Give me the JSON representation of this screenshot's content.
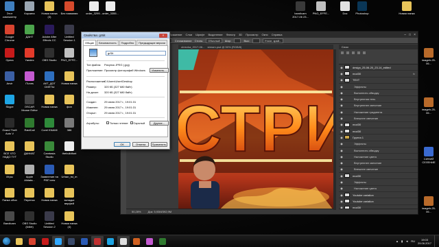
{
  "desktop": {
    "left_icons": [
      {
        "label": "Этот компьютер",
        "color": "#3f7fbf"
      },
      {
        "label": "Корзина",
        "color": "#9aa6b2"
      },
      {
        "label": "Новая папка (3)",
        "color": "#e8c45a"
      },
      {
        "label": "Без названия",
        "color": "#d64a2c"
      },
      {
        "label": "Google Chrome",
        "color": "#d8432f"
      },
      {
        "label": "ДАНТ",
        "color": "#4ca44c"
      },
      {
        "label": "Adobe After Effects CC",
        "color": "#2a1a5a"
      },
      {
        "label": "Untitled Session 1",
        "color": "#3a3a4a"
      },
      {
        "label": "Opera",
        "color": "#c61a1a"
      },
      {
        "label": "Yandex",
        "color": "#e23a2a"
      },
      {
        "label": "OBS Studio",
        "color": "#303030"
      },
      {
        "label": "PNG_EFFE...",
        "color": "#c0c0c0"
      },
      {
        "label": "Anvir",
        "color": "#3b5fa4"
      },
      {
        "label": "iTunes",
        "color": "#c45ad0"
      },
      {
        "label": "АКТ_ДОГ СМЕТЫ",
        "color": "#2e6fbf"
      },
      {
        "label": "Новая папка",
        "color": "#e8c45a"
      },
      {
        "label": "Skype",
        "color": "#1ea5e4"
      },
      {
        "label": "OSCAR Mouse Editor",
        "color": "#444"
      },
      {
        "label": "Новая папка",
        "color": "#e8c45a"
      },
      {
        "label": "фон",
        "color": "#e8c45a"
      },
      {
        "label": "Grand Theft Auto V",
        "color": "#2a2a2a"
      },
      {
        "label": "RaidCall",
        "color": "#2f7a2f"
      },
      {
        "label": "Corel KNAMI",
        "color": "#2e8a3a"
      },
      {
        "label": "386",
        "color": "#7a7a7a"
      },
      {
        "label": "ВСЕ ЧТО НАДО ТУТ",
        "color": "#e8c45a"
      },
      {
        "label": "ДАНИАТ",
        "color": "#e8c45a"
      },
      {
        "label": "Camtasia Studio",
        "color": "#3a8a3a"
      },
      {
        "label": "thebuildfont",
        "color": "#ececec"
      },
      {
        "label": "Игры",
        "color": "#e8c45a"
      },
      {
        "label": "Apple Alldata...",
        "color": "#b0b0b0"
      },
      {
        "label": "Заявление на РВП new",
        "color": "#2b5bb5"
      },
      {
        "label": "Urban_tst_m",
        "color": "#e8c45a"
      },
      {
        "label": "Папка обои",
        "color": "#e8c45a"
      },
      {
        "label": "Перенос",
        "color": "#e8c45a"
      },
      {
        "label": "Новая папка",
        "color": "#e8c45a"
      },
      {
        "label": "вкладки верфей",
        "color": "#e8c45a"
      },
      {
        "label": "Bandicam",
        "color": "#4a4a4a"
      },
      {
        "label": "OBS Studio (64bit)",
        "color": "#303030"
      },
      {
        "label": "Untitled Session 2",
        "color": "#3a3a4a"
      },
      {
        "label": "Новая папка (4)",
        "color": "#e8c45a"
      }
    ],
    "top_icons": [
      {
        "label": "order_3299...",
        "color": "#ececec"
      },
      {
        "label": "order_3355...",
        "color": "#ececec"
      },
      {
        "label": "bandicam 2017-06 23...",
        "color": "#3a3a3a"
      },
      {
        "label": "PNG_EFFE...",
        "color": "#c0c0c0"
      },
      {
        "label": "Doc",
        "color": "#e2e2e2"
      },
      {
        "label": "Photoshop",
        "color": "#0a3656"
      },
      {
        "label": "Новая папка",
        "color": "#e8c45a"
      }
    ],
    "right_icons": [
      {
        "label": "imageb-25-06...",
        "color": "#b86a2a"
      },
      {
        "label": "imageb-25-06...",
        "color": "#b86a2a"
      },
      {
        "label": "СИНИЙ СЕЛЕНИЕ",
        "color": "#3a6ad0"
      },
      {
        "label": "imageb-25-06...",
        "color": "#b86a2a"
      }
    ]
  },
  "photoshop": {
    "logo": "Ps",
    "menu": [
      "Файл",
      "Редактирование",
      "Изображение",
      "Слои",
      "Шрифт",
      "Выделение",
      "Фильтр",
      "3D",
      "Просмотр",
      "Окно",
      "Справка"
    ],
    "window_controls": [
      "–",
      "□",
      "×"
    ],
    "options_bar": {
      "mode_label": "Растушевка:",
      "mode_value": "0 пикс",
      "feather": "Сглаживание",
      "style_label": "Стиль:",
      "style_value": "Обычный",
      "width_label": "Шир:",
      "height_label": "Выс:",
      "refine_button": "Уточн. край..."
    },
    "doc_tabs": [
      "obrezka_2017-06...",
      "stream.psd @ 50% (RGB/8)"
    ],
    "status": {
      "zoom": "50,28%",
      "doc_size": "Док: 5,93M/392,9M"
    },
    "canvas_text": "СТРИ",
    "layers_panel": {
      "tabs": "Слои",
      "rows": [
        {
          "name": "design_25-06-20_23-14_edited",
          "type": "layer",
          "fx": false
        },
        {
          "name": "mod30",
          "type": "layer",
          "fx": true
        },
        {
          "name": "TEXT",
          "type": "layer",
          "fx": false
        },
        {
          "name": "Эффекты",
          "type": "fx"
        },
        {
          "name": "Выполнить обводку",
          "type": "fx"
        },
        {
          "name": "Внутренняя тень",
          "type": "fx"
        },
        {
          "name": "Внутреннее свечение",
          "type": "fx"
        },
        {
          "name": "Наложение градиента",
          "type": "fx"
        },
        {
          "name": "Внешнее свечение",
          "type": "fx"
        },
        {
          "name": "mod30",
          "type": "layer",
          "fx": false
        },
        {
          "name": "mod30",
          "type": "layer",
          "fx": false
        },
        {
          "name": "Группа 1",
          "type": "group",
          "fx": false
        },
        {
          "name": "Эффекты",
          "type": "fx"
        },
        {
          "name": "Выполнить обводку",
          "type": "fx"
        },
        {
          "name": "Наложение цвета",
          "type": "fx"
        },
        {
          "name": "Внутреннее свечение",
          "type": "fx"
        },
        {
          "name": "Внешнее свечение",
          "type": "fx"
        },
        {
          "name": "mod30",
          "type": "layer",
          "fx": false
        },
        {
          "name": "Эффекты",
          "type": "fx"
        },
        {
          "name": "Наложение цвета",
          "type": "fx"
        },
        {
          "name": "Youtube variation",
          "type": "layer",
          "fx": false
        },
        {
          "name": "Youtube variation",
          "type": "layer",
          "fx": false
        },
        {
          "name": "mod30",
          "type": "layer",
          "fx": false
        },
        {
          "name": "mod30",
          "type": "layer",
          "fx": false
        },
        {
          "name": "Эффекты",
          "type": "fx"
        },
        {
          "name": "Внутренняя тень",
          "type": "fx"
        },
        {
          "name": "Внешнее свечение",
          "type": "fx"
        },
        {
          "name": "mod30",
          "type": "layer",
          "fx": false
        }
      ]
    }
  },
  "dialog": {
    "title": "Свойства: grSit",
    "close": "×",
    "tabs": [
      "Общие",
      "Безопасность",
      "Подробно",
      "Предыдущие версии"
    ],
    "file_name": "grSit",
    "type_label": "Тип файла:",
    "type_value": "Рисунок JPEG (.jpg)",
    "app_label": "Приложение:",
    "app_value": "Просмотр фотографий Windows",
    "change_button": "Изменить...",
    "location_label": "Расположение:",
    "location_value": "C:\\Users\\User\\Desktop",
    "size_label": "Размер:",
    "size_value": "320 КБ (327 680 байт)",
    "disk_label": "На диске:",
    "disk_value": "320 КБ (327 680 байт)",
    "created_label": "Создан:",
    "created_value": "29 июня 2017 г., 19:01:31",
    "modified_label": "Изменен:",
    "modified_value": "29 июня 2017 г., 19:01:31",
    "opened_label": "Открыт:",
    "opened_value": "29 июня 2017 г., 19:01:31",
    "attrs_label": "Атрибуты:",
    "attr_readonly": "Только чтение",
    "attr_hidden": "Скрытый",
    "other_button": "Другие...",
    "ok": "ОК",
    "cancel": "Отмена",
    "apply": "Применить"
  },
  "taskbar": {
    "apps": [
      {
        "name": "explorer",
        "color": "#e8c45a",
        "active": false
      },
      {
        "name": "chrome",
        "color": "#d8432f",
        "active": false
      },
      {
        "name": "opera",
        "color": "#c61a1a",
        "active": false
      },
      {
        "name": "photoshop",
        "color": "#31a8ff",
        "active": true
      },
      {
        "name": "steam",
        "color": "#3a4a6a",
        "active": false
      },
      {
        "name": "word",
        "color": "#2b5bb5",
        "active": false
      },
      {
        "name": "bandicam",
        "color": "#c03030",
        "active": true
      },
      {
        "name": "skype",
        "color": "#1ea5e4",
        "active": false
      },
      {
        "name": "obs",
        "color": "#e0e0e0",
        "active": true
      },
      {
        "name": "media",
        "color": "#d06020",
        "active": false
      },
      {
        "name": "itunes",
        "color": "#c45ad0",
        "active": false
      },
      {
        "name": "raidcall",
        "color": "#2f7a2f",
        "active": false
      }
    ],
    "lang": "RU",
    "time": "19:03",
    "date": "29.06.2017"
  }
}
